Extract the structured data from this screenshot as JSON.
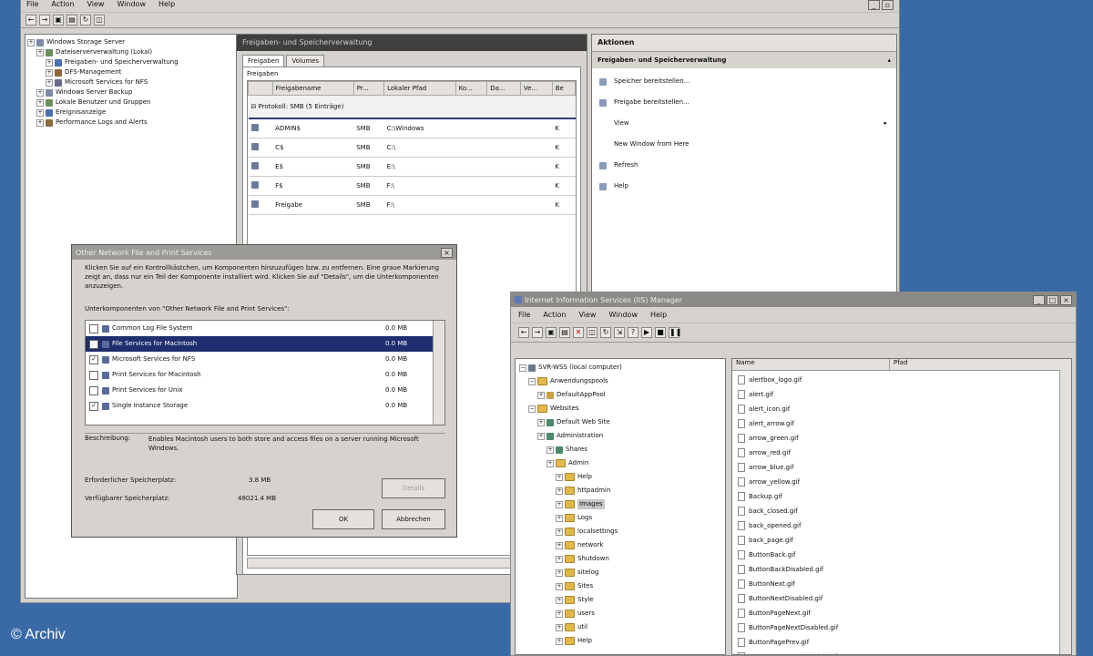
{
  "main_window": {
    "menu": [
      "File",
      "Action",
      "View",
      "Window",
      "Help"
    ],
    "tree": [
      {
        "label": "Windows Storage Server",
        "level": 0
      },
      {
        "label": "Dateiserververwaltung (Lokal)",
        "level": 1
      },
      {
        "label": "Freigaben- und Speicherverwaltung",
        "level": 2
      },
      {
        "label": "DFS-Management",
        "level": 2
      },
      {
        "label": "Microsoft Services for NFS",
        "level": 2
      },
      {
        "label": "Windows Server Backup",
        "level": 1
      },
      {
        "label": "Lokale Benutzer und Gruppen",
        "level": 1
      },
      {
        "label": "Ereignisanzeige",
        "level": 1
      },
      {
        "label": "Performance Logs and Alerts",
        "level": 1
      }
    ],
    "center_header": "Freigaben- und Speicherverwaltung",
    "tabs": [
      "Freigaben",
      "Volumes"
    ],
    "table_label": "Freigaben",
    "columns": [
      "",
      "Freigabename",
      "Pr...",
      "Lokaler Pfad",
      "Ko...",
      "Da...",
      "Ve...",
      "Be"
    ],
    "group_label": "Protokoll: SMB (5 Einträge)",
    "rows": [
      {
        "name": "ADMIN$",
        "proto": "SMB",
        "path": "C:\\Windows",
        "end": "K"
      },
      {
        "name": "C$",
        "proto": "SMB",
        "path": "C:\\",
        "end": "K"
      },
      {
        "name": "E$",
        "proto": "SMB",
        "path": "E:\\",
        "end": "K"
      },
      {
        "name": "F$",
        "proto": "SMB",
        "path": "F:\\",
        "end": "K"
      },
      {
        "name": "Freigabe",
        "proto": "SMB",
        "path": "F:\\",
        "end": "K"
      }
    ],
    "actions_header": "Aktionen",
    "actions_section": "Freigaben- und Speicherverwaltung",
    "actions": [
      {
        "label": "Speicher bereitstellen...",
        "icon": "storage-icon"
      },
      {
        "label": "Freigabe bereitstellen...",
        "icon": "share-icon"
      },
      {
        "label": "View",
        "icon": "",
        "submenu": true
      },
      {
        "label": "New Window from Here",
        "icon": ""
      },
      {
        "label": "Refresh",
        "icon": "refresh-icon"
      },
      {
        "label": "Help",
        "icon": "help-icon"
      }
    ]
  },
  "dialog": {
    "title": "Other Network File and Print Services",
    "description": "Klicken Sie auf ein Kontrollkästchen, um Komponenten hinzuzufügen bzw. zu entfernen. Eine graue Markierung zeigt an, dass nur ein Teil der Komponente installiert wird. Klicken Sie auf \"Details\", um die Unterkomponenten anzuzeigen.",
    "subcomponents_label": "Unterkomponenten von \"Other Network File and Print Services\":",
    "items": [
      {
        "label": "Common Log File System",
        "size": "0.0 MB",
        "checked": false,
        "selected": false
      },
      {
        "label": "File Services for Macintosh",
        "size": "0.0 MB",
        "checked": false,
        "selected": true
      },
      {
        "label": "Microsoft Services for NFS",
        "size": "0.0 MB",
        "checked": true,
        "selected": false
      },
      {
        "label": "Print Services for Macintosh",
        "size": "0.0 MB",
        "checked": false,
        "selected": false
      },
      {
        "label": "Print Services for Unix",
        "size": "0.0 MB",
        "checked": false,
        "selected": false
      },
      {
        "label": "Single Instance Storage",
        "size": "0.0 MB",
        "checked": true,
        "selected": false
      }
    ],
    "desc_label": "Beschreibung:",
    "desc_text": "Enables Macintosh users to both store and access files on a server running Microsoft Windows.",
    "required_label": "Erforderlicher Speicherplatz:",
    "required_value": "3.8 MB",
    "available_label": "Verfügbarer Speicherplatz:",
    "available_value": "48021.4 MB",
    "details_button": "Details",
    "ok_button": "OK",
    "cancel_button": "Abbrechen"
  },
  "iis_window": {
    "title": "Internet Information Services (IIS) Manager",
    "menu": [
      "File",
      "Action",
      "View",
      "Window",
      "Help"
    ],
    "tree": [
      {
        "label": "SVR-WSS (local computer)",
        "level": 0,
        "type": "computer"
      },
      {
        "label": "Anwendungspools",
        "level": 1,
        "type": "folder"
      },
      {
        "label": "DefaultAppPool",
        "level": 2,
        "type": "pool"
      },
      {
        "label": "Websites",
        "level": 1,
        "type": "folder"
      },
      {
        "label": "Default Web Site",
        "level": 2,
        "type": "site"
      },
      {
        "label": "Administration",
        "level": 2,
        "type": "site"
      },
      {
        "label": "Shares",
        "level": 3,
        "type": "site"
      },
      {
        "label": "Admin",
        "level": 3,
        "type": "folder"
      },
      {
        "label": "Help",
        "level": 4,
        "type": "folder"
      },
      {
        "label": "httpadmin",
        "level": 4,
        "type": "folder"
      },
      {
        "label": "Images",
        "level": 4,
        "type": "folder",
        "selected": true
      },
      {
        "label": "Logs",
        "level": 4,
        "type": "folder"
      },
      {
        "label": "localsettings",
        "level": 4,
        "type": "folder"
      },
      {
        "label": "network",
        "level": 4,
        "type": "folder"
      },
      {
        "label": "Shutdown",
        "level": 4,
        "type": "folder"
      },
      {
        "label": "sitelog",
        "level": 4,
        "type": "folder"
      },
      {
        "label": "Sites",
        "level": 4,
        "type": "folder"
      },
      {
        "label": "Style",
        "level": 4,
        "type": "folder"
      },
      {
        "label": "users",
        "level": 4,
        "type": "folder"
      },
      {
        "label": "util",
        "level": 4,
        "type": "folder"
      },
      {
        "label": "Help",
        "level": 4,
        "type": "folder"
      }
    ],
    "list_columns": [
      "Name",
      "Pfad"
    ],
    "files": [
      "alertbox_logo.gif",
      "alert.gif",
      "alert_icon.gif",
      "alert_arrow.gif",
      "arrow_green.gif",
      "arrow_red.gif",
      "arrow_blue.gif",
      "arrow_yellow.gif",
      "Backup.gif",
      "back_closed.gif",
      "back_opened.gif",
      "back_page.gif",
      "ButtonBack.gif",
      "ButtonBackDisabled.gif",
      "ButtonNext.gif",
      "ButtonNextDisabled.gif",
      "ButtonPageNext.gif",
      "ButtonPageNextDisabled.gif",
      "ButtonPagePrev.gif",
      "ButtonPagePrevDisabled.gif"
    ]
  },
  "watermark": "© Archiv"
}
